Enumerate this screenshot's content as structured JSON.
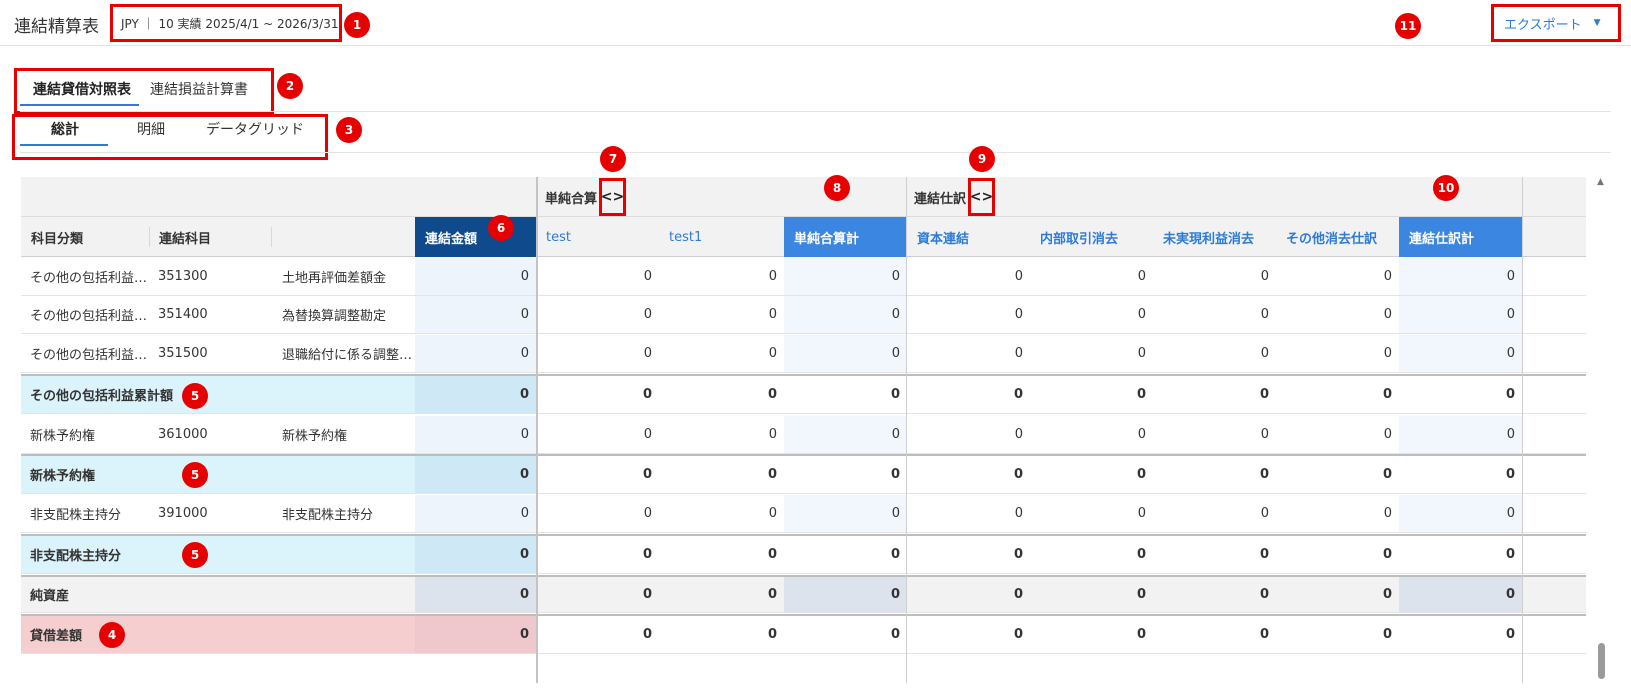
{
  "header": {
    "title": "連結精算表",
    "context": "JPY ｜ 10 実績 2025/4/1 ~ 2026/3/31",
    "export_label": "エクスポート"
  },
  "tabs_primary": [
    {
      "label": "連結貸借対照表",
      "active": true
    },
    {
      "label": "連結損益計算書",
      "active": false
    }
  ],
  "tabs_secondary": [
    {
      "label": "総計",
      "active": true
    },
    {
      "label": "明細",
      "active": false
    },
    {
      "label": "データグリッド",
      "active": false
    }
  ],
  "markers": [
    "1",
    "2",
    "3",
    "4",
    "5",
    "5",
    "5",
    "6",
    "7",
    "8",
    "9",
    "10",
    "11"
  ],
  "grid": {
    "group_simple": "単純合算",
    "group_elim": "連結仕訳",
    "toggle_icon": "<>",
    "columns": {
      "category": "科目分類",
      "account": "連結科目",
      "total": "連結金額",
      "entity1": "test",
      "entity2": "test1",
      "simple_total": "単純合算計",
      "elim1": "資本連結",
      "elim2": "内部取引消去",
      "elim3": "未実現利益消去",
      "elim4": "その他消去仕訳",
      "elim_total": "連結仕訳計"
    },
    "rows": [
      {
        "type": "detail",
        "category": "その他の包括利益…",
        "code": "351300",
        "name": "土地再評価差額金",
        "values": [
          "0",
          "0",
          "0",
          "0",
          "0",
          "0",
          "0",
          "0",
          "0"
        ]
      },
      {
        "type": "detail",
        "category": "その他の包括利益…",
        "code": "351400",
        "name": "為替換算調整勘定",
        "values": [
          "0",
          "0",
          "0",
          "0",
          "0",
          "0",
          "0",
          "0",
          "0"
        ]
      },
      {
        "type": "detail",
        "category": "その他の包括利益…",
        "code": "351500",
        "name": "退職給付に係る調整…",
        "values": [
          "0",
          "0",
          "0",
          "0",
          "0",
          "0",
          "0",
          "0",
          "0"
        ]
      },
      {
        "type": "subtotal",
        "category": "その他の包括利益累計額",
        "code": "",
        "name": "",
        "values": [
          "0",
          "0",
          "0",
          "0",
          "0",
          "0",
          "0",
          "0",
          "0"
        ]
      },
      {
        "type": "detail",
        "category": "新株予約権",
        "code": "361000",
        "name": "新株予約権",
        "values": [
          "0",
          "0",
          "0",
          "0",
          "0",
          "0",
          "0",
          "0",
          "0"
        ]
      },
      {
        "type": "subtotal",
        "category": "新株予約権",
        "code": "",
        "name": "",
        "values": [
          "0",
          "0",
          "0",
          "0",
          "0",
          "0",
          "0",
          "0",
          "0"
        ]
      },
      {
        "type": "detail",
        "category": "非支配株主持分",
        "code": "391000",
        "name": "非支配株主持分",
        "values": [
          "0",
          "0",
          "0",
          "0",
          "0",
          "0",
          "0",
          "0",
          "0"
        ]
      },
      {
        "type": "subtotal",
        "category": "非支配株主持分",
        "code": "",
        "name": "",
        "values": [
          "0",
          "0",
          "0",
          "0",
          "0",
          "0",
          "0",
          "0",
          "0"
        ]
      },
      {
        "type": "net",
        "category": "純資産",
        "code": "",
        "name": "",
        "values": [
          "0",
          "0",
          "0",
          "0",
          "0",
          "0",
          "0",
          "0",
          "0"
        ]
      },
      {
        "type": "diff",
        "category": "貸借差額",
        "code": "",
        "name": "",
        "values": [
          "0",
          "0",
          "0",
          "0",
          "0",
          "0",
          "0",
          "0",
          "0"
        ]
      }
    ]
  },
  "colors": {
    "accent": "#2e7bd6",
    "total_header": "#0f4a8c",
    "sum_header": "#3b86e0",
    "marker": "#e60000"
  }
}
